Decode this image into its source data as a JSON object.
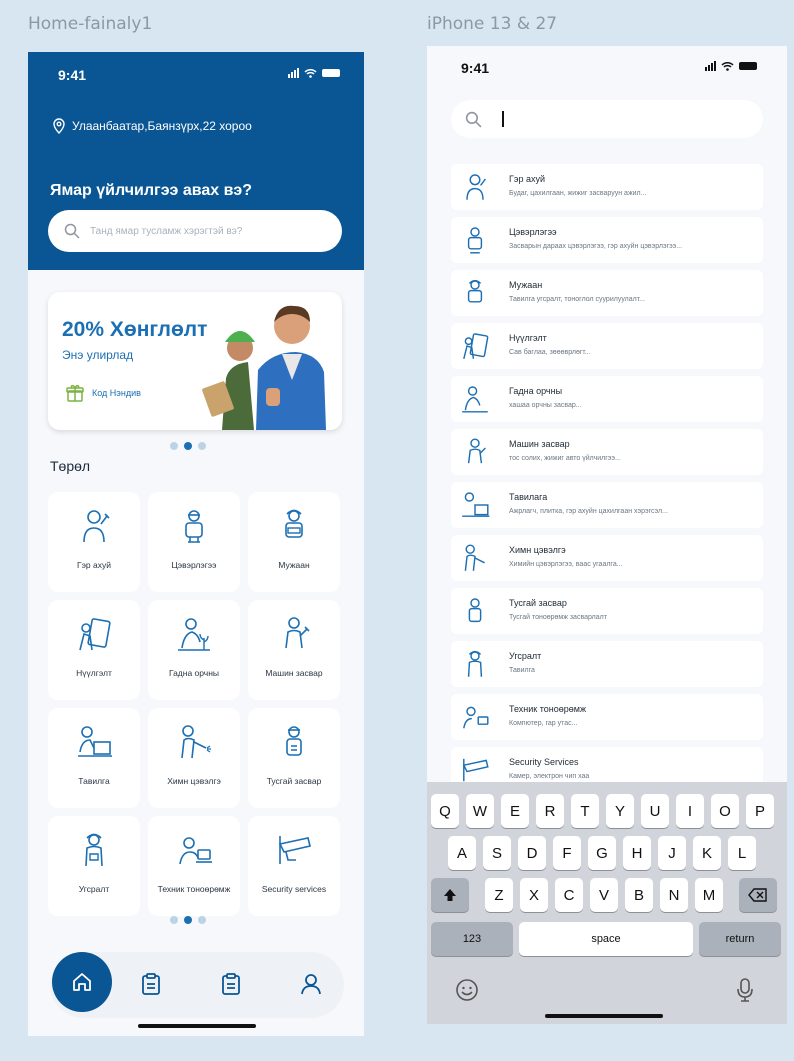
{
  "frames": {
    "left": "Home-fainaly1",
    "right": "iPhone 13 & 27"
  },
  "status": {
    "time": "9:41"
  },
  "home": {
    "location": "Улаанбаатар,Баянзүрх,22 хороо",
    "question": "Ямар үйлчилгээ авах вэ?",
    "search_placeholder": "Танд ямар тусламж хэрэгтэй вэ?",
    "banner": {
      "title": "20% Хөнглөлт",
      "subtitle": "Энэ улирлад",
      "code_label": "Код Нэндив"
    },
    "section_title": "Төрөл",
    "categories": [
      {
        "label": "Гэр ахуй",
        "icon": "housekeeper-icon"
      },
      {
        "label": "Цэвэрлэгээ",
        "icon": "cleaner-icon"
      },
      {
        "label": "Мужаан",
        "icon": "carpenter-icon"
      },
      {
        "label": "Нүүлгэлт",
        "icon": "moving-icon"
      },
      {
        "label": "Гадна орчны",
        "icon": "gardening-icon"
      },
      {
        "label": "Машин засвар",
        "icon": "mechanic-icon"
      },
      {
        "label": "Тавилга",
        "icon": "furniture-icon"
      },
      {
        "label": "Химн цэвэлгэ",
        "icon": "pest-control-icon"
      },
      {
        "label": "Тусгай засвар",
        "icon": "repair-icon"
      },
      {
        "label": "Угсралт",
        "icon": "assembly-icon"
      },
      {
        "label": "Техник тоноөрөмж",
        "icon": "tech-support-icon"
      },
      {
        "label": "Security services",
        "icon": "security-camera-icon"
      }
    ],
    "nav": [
      "home-icon",
      "orders-icon",
      "history-icon",
      "profile-icon"
    ]
  },
  "search": {
    "value": "",
    "results": [
      {
        "title": "Гэр ахуй",
        "desc": "Будаг, цахилгаан, жижиг засваруун ажил...",
        "icon": "housekeeper-icon"
      },
      {
        "title": "Цэвэрлэгээ",
        "desc": "Засварын дараах цэвэрлэгээ, гэр ахуйн цэвэрлэгээ...",
        "icon": "cleaner-icon"
      },
      {
        "title": "Мужаан",
        "desc": "Тавилга угсралт, тоноглол суурилуулалт...",
        "icon": "carpenter-icon"
      },
      {
        "title": "Нүүлгэлт",
        "desc": "Сав баглаа, зөөөврлөгт...",
        "icon": "moving-icon"
      },
      {
        "title": "Гадна орчны",
        "desc": "хашаа орчны засвар...",
        "icon": "gardening-icon"
      },
      {
        "title": "Машин засвар",
        "desc": "тос солих, жижиг авто үйлчилгээ...",
        "icon": "mechanic-icon"
      },
      {
        "title": "Тавилага",
        "desc": "Ажрлагч, плитка, гэр ахуйн цахилгаан хэрэгсэл...",
        "icon": "furniture-icon"
      },
      {
        "title": "Химн цэвэлгэ",
        "desc": "Химийн цэвэрлэгээ, ваас угаалга...",
        "icon": "pest-control-icon"
      },
      {
        "title": "Тусгай засвар",
        "desc": "Тусгай тоноөрөмж засварлалт",
        "icon": "repair-icon"
      },
      {
        "title": "Угсралт",
        "desc": "Тавилга",
        "icon": "assembly-icon"
      },
      {
        "title": "Техник тоноөрөмж",
        "desc": "Компютер, гар утас...",
        "icon": "tech-support-icon"
      },
      {
        "title": "Security Services",
        "desc": "Камер, электрон чип хаа",
        "icon": "security-camera-icon"
      }
    ]
  },
  "keyboard": {
    "row1": [
      "Q",
      "W",
      "E",
      "R",
      "T",
      "Y",
      "U",
      "I",
      "O",
      "P"
    ],
    "row2": [
      "A",
      "S",
      "D",
      "F",
      "G",
      "H",
      "J",
      "K",
      "L"
    ],
    "row3": [
      "Z",
      "X",
      "C",
      "V",
      "B",
      "N",
      "M"
    ],
    "numbers": "123",
    "space": "space",
    "return": "return"
  },
  "colors": {
    "primary": "#0a5694",
    "accent": "#1c6fb3",
    "background": "#d8e6f1",
    "banner_gift": "#7cb342"
  }
}
